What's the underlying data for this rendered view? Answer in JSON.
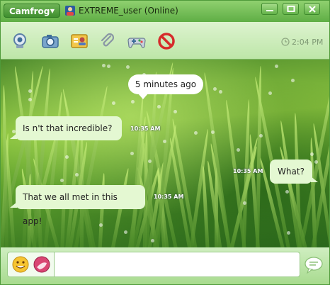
{
  "titlebar": {
    "app_menu_label": "Camfrog",
    "window_title": "EXTREME_user (Online)"
  },
  "toolbar": {
    "items": [
      "webcam-icon",
      "camera-icon",
      "contact-card-icon",
      "paperclip-icon",
      "gamepad-icon",
      "block-icon"
    ],
    "time": "2:04 PM"
  },
  "messages": {
    "system": "5 minutes ago",
    "m1": {
      "text": "Is n't that incredible?",
      "time": "10:35 AM"
    },
    "m2": {
      "text": "What?",
      "time": "10:35 AM"
    },
    "m3": {
      "text": "That we all met in this app!",
      "time": "10:35 AM"
    }
  },
  "input": {
    "value": "",
    "placeholder": ""
  },
  "colors": {
    "accent": "#5fae45",
    "bubble": "#e4f8d2",
    "title_bar": "#7cc35f"
  }
}
